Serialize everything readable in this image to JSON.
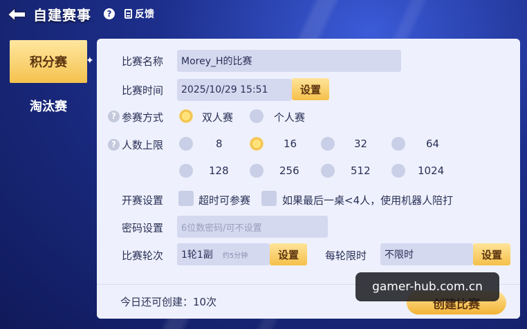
{
  "header": {
    "title": "自建赛事",
    "help": "?",
    "feedback_label": "反馈"
  },
  "sidebar": {
    "items": [
      {
        "label": "积分赛",
        "active": true
      },
      {
        "label": "淘汰赛",
        "active": false
      }
    ]
  },
  "form": {
    "match_name": {
      "label": "比赛名称",
      "value": "Morey_H的比赛"
    },
    "match_time": {
      "label": "比赛时间",
      "value": "2025/10/29 15:51",
      "button": "设置"
    },
    "mode": {
      "label": "参赛方式",
      "help": "?",
      "options": [
        "双人赛",
        "个人赛"
      ],
      "selected": "双人赛"
    },
    "max_players": {
      "label": "人数上限",
      "help": "?",
      "options": [
        "8",
        "16",
        "32",
        "64",
        "128",
        "256",
        "512",
        "1024"
      ],
      "selected": "16"
    },
    "start_settings": {
      "label": "开赛设置",
      "options": [
        "超时可参赛",
        "如果最后一桌<4人，使用机器人陪打"
      ]
    },
    "password": {
      "label": "密码设置",
      "placeholder": "6位数密码/可不设置"
    },
    "rounds": {
      "label": "比赛轮次",
      "value": "1轮1副",
      "hint": "约5分钟",
      "button": "设置"
    },
    "round_limit": {
      "label": "每轮限时",
      "value": "不限时",
      "button": "设置"
    }
  },
  "footer": {
    "quota_text": "今日还可创建：10次",
    "create_button": "创建比赛"
  },
  "watermark": "gamer-hub.com.cn",
  "colors": {
    "accent": "#f5c04a",
    "panel": "#eef1fd",
    "background": "#1d2f8c"
  }
}
